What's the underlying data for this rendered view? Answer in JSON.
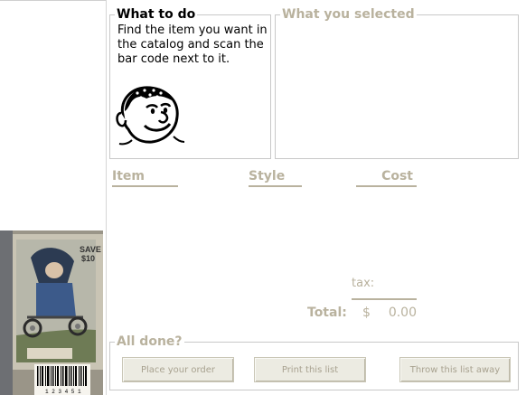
{
  "what_to_do": {
    "title": "What to do",
    "instructions": "Find the item you want in the catalog and scan the bar code next to it."
  },
  "what_you_selected": {
    "title": "What you selected"
  },
  "columns": {
    "item": "Item",
    "style": "Style",
    "cost": "Cost"
  },
  "totals": {
    "tax_label": "tax:",
    "total_label": "Total:",
    "currency": "$",
    "total_value": "0.00"
  },
  "all_done": {
    "title": "All done?",
    "place_order": "Place your order",
    "print_list": "Print this list",
    "throw_away": "Throw this list away"
  },
  "catalog_photo": {
    "badge": "SAVE\n$10",
    "barcode_digits": "1 2 3 4 5 1"
  },
  "colors": {
    "muted_text": "#b9b29e",
    "button_face": "#ecebe2",
    "panel_border": "#c8c8c8"
  }
}
